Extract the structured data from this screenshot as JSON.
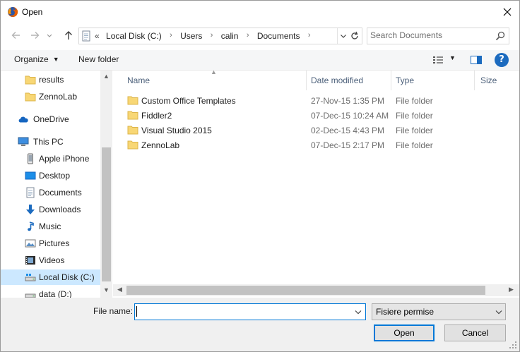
{
  "window": {
    "title": "Open"
  },
  "address": {
    "overflow": "«",
    "crumbs": [
      "Local Disk (C:)",
      "Users",
      "calin",
      "Documents"
    ]
  },
  "search": {
    "placeholder": "Search Documents"
  },
  "toolbar": {
    "organize": "Organize",
    "new_folder": "New folder"
  },
  "navpane": {
    "items": [
      {
        "label": "results",
        "icon": "folder-icon"
      },
      {
        "label": "ZennoLab",
        "icon": "folder-icon"
      },
      {
        "label": "OneDrive",
        "icon": "cloud-icon"
      },
      {
        "label": "This PC",
        "icon": "computer-icon"
      },
      {
        "label": "Apple iPhone",
        "icon": "phone-icon"
      },
      {
        "label": "Desktop",
        "icon": "desktop-icon"
      },
      {
        "label": "Documents",
        "icon": "documents-icon"
      },
      {
        "label": "Downloads",
        "icon": "download-icon"
      },
      {
        "label": "Music",
        "icon": "music-icon"
      },
      {
        "label": "Pictures",
        "icon": "pictures-icon"
      },
      {
        "label": "Videos",
        "icon": "videos-icon"
      },
      {
        "label": "Local Disk (C:)",
        "icon": "drive-icon",
        "selected": true
      },
      {
        "label": "data (D:)",
        "icon": "drive-icon"
      }
    ]
  },
  "files": {
    "columns": [
      "Name",
      "Date modified",
      "Type",
      "Size"
    ],
    "rows": [
      {
        "name": "Custom Office Templates",
        "date": "27-Nov-15 1:35 PM",
        "type": "File folder"
      },
      {
        "name": "Fiddler2",
        "date": "07-Dec-15 10:24 AM",
        "type": "File folder"
      },
      {
        "name": "Visual Studio 2015",
        "date": "02-Dec-15 4:43 PM",
        "type": "File folder"
      },
      {
        "name": "ZennoLab",
        "date": "07-Dec-15 2:17 PM",
        "type": "File folder"
      }
    ]
  },
  "bottom": {
    "file_name_label": "File name:",
    "file_name_value": "",
    "file_type": "Fisiere permise",
    "open_label": "Open",
    "cancel_label": "Cancel"
  },
  "colors": {
    "accent": "#0078d7",
    "folder": "#f8d775",
    "selection": "#cce8ff",
    "help": "#1c6bbf"
  }
}
